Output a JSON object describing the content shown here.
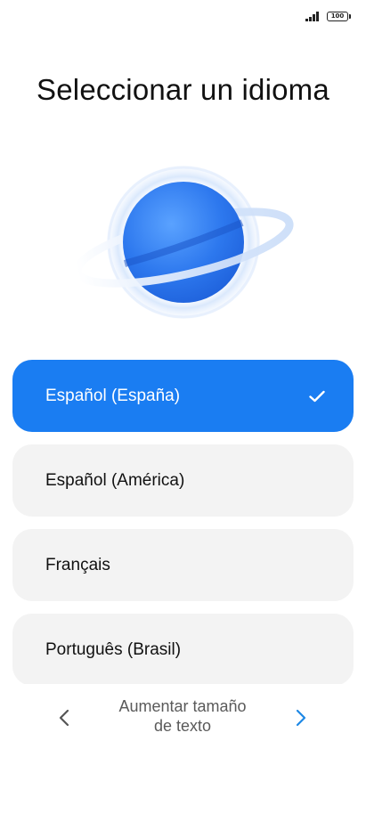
{
  "status_bar": {
    "battery_level": "100",
    "icons": [
      "signal-icon",
      "battery-icon"
    ]
  },
  "title": "Seleccionar un idioma",
  "illustration": {
    "icon": "planet-icon",
    "colors": {
      "planet": "#2f7cf0",
      "ring": "#dbe8fb"
    }
  },
  "languages": [
    {
      "label": "Español (España)",
      "selected": true
    },
    {
      "label": "Español (América)",
      "selected": false
    },
    {
      "label": "Français",
      "selected": false
    },
    {
      "label": "Português (Brasil)",
      "selected": false
    }
  ],
  "bottom_nav": {
    "prev_icon": "chevron-left-icon",
    "next_icon": "chevron-right-icon",
    "text_size_line1": "Aumentar tamaño",
    "text_size_line2": "de texto"
  },
  "colors": {
    "accent": "#1a7df2",
    "item_background": "#f3f3f3",
    "next_arrow": "#1e88e5",
    "prev_arrow": "#555555"
  }
}
